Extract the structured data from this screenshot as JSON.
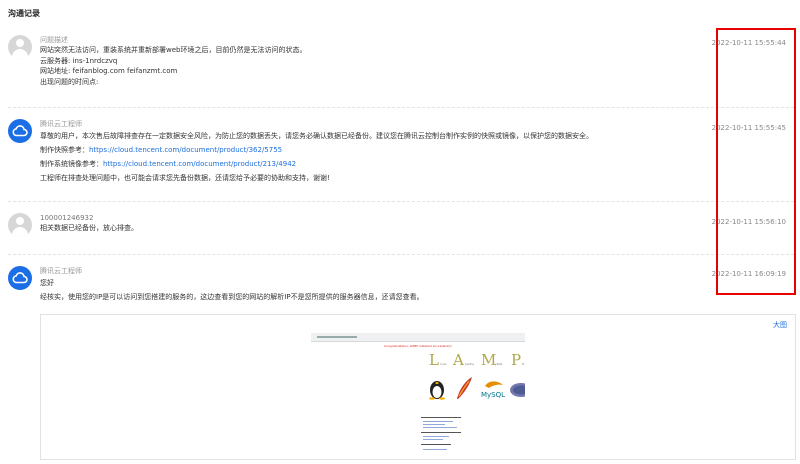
{
  "page": {
    "title": "沟通记录"
  },
  "entries": [
    {
      "name": "问题描述",
      "time": "2022-10-11 15:55:44",
      "lines": [
        "网站突然无法访问，重装系统并重新部署web环境之后，目前仍然是无法访问的状态。",
        "云服务器: ins-1nrdczvq",
        "网站地址: feifanblog.com feifanzmt.com",
        "出现问题的时间点:"
      ]
    },
    {
      "name": "腾讯云工程师",
      "time": "2022-10-11 15:55:45",
      "line1": "尊敬的用户，本次售后故障排查存在一定数据安全风险，为防止您的数据丢失，请您务必确认数据已经备份。建议您在腾讯云控制台制作实例的快照或镜像，以保护您的数据安全。",
      "snapshot_label": "制作快照参考：",
      "snapshot_link": "https://cloud.tencent.com/document/product/362/5755",
      "image_label": "制作系统镜像参考：",
      "image_link": "https://cloud.tencent.com/document/product/213/4942",
      "line4": "工程师在排查处理问题中，也可能会请求您先备份数据，还请您给予必要的协助和支持，谢谢!"
    },
    {
      "name": "100001246932",
      "time": "2022-10-11 15:56:10",
      "lines": [
        "相关数据已经备份，放心排查。"
      ]
    },
    {
      "name": "腾讯云工程师",
      "time": "2022-10-11 16:09:19",
      "lines": [
        "您好",
        " 经核实，使用您的IP是可以访问到您搭建的服务的，这边查看到您的网站的解析IP不是您所提供的服务器信息，还请您查看。"
      ],
      "expand_label": "大图"
    }
  ],
  "screenshot": {
    "banner": "Congratulations, LNMP installed successfully!",
    "big_letters": [
      "L",
      "A",
      "M",
      "P"
    ],
    "small_words": [
      "inux",
      "pache",
      "ySQL",
      "H"
    ]
  },
  "colors": {
    "link": "#1e6fdc",
    "highlight": "#e60000",
    "engineer_avatar": "#1b6ee5"
  }
}
